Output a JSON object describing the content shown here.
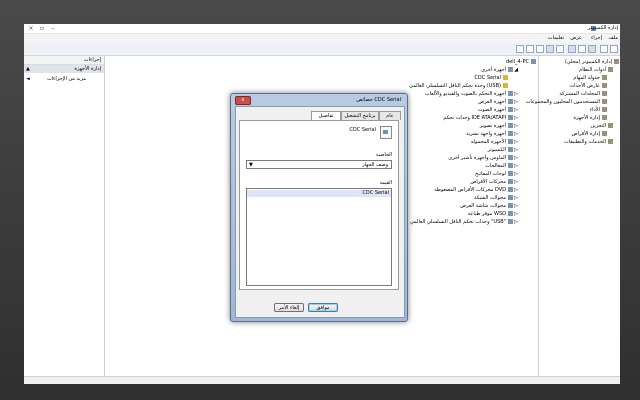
{
  "window": {
    "title": "إدارة الكمبيوتر",
    "controls": {
      "close": "×",
      "maximize": "▫",
      "minimize": "–"
    }
  },
  "menu": [
    "ملف",
    "إجراء",
    "عرض",
    "تعليمات"
  ],
  "left_pane": {
    "header": "إجراءات",
    "selected": "إدارة الأجهزة",
    "more_actions": "مزيد من الإجراءات"
  },
  "device_tree": {
    "root": "dell_4-PC",
    "items": [
      "أجهزة أخرى",
      "CDC Serial",
      "وحدة تحكم الناقل التسلسلي العالمي (USB)",
      "أجهزة التحكم بالصوت والفيديو والألعاب",
      "أجهزة العرض",
      "أجهزة الصوت",
      "وحدات تحكم IDE ATA/ATAPI",
      "أجهزة تصوير",
      "أجهزة واجهة بشرية",
      "الأجهزة المحمولة",
      "الكمبيوتر",
      "الماوس وأجهزة تأشير أخرى",
      "المعالجات",
      "لوحات المفاتيح",
      "محركات الأقراص",
      "محركات الأقراص المضغوطة DVD",
      "محولات الشبكة",
      "محولات شاشة العرض",
      "موفر طباعة WSD",
      "وحدات تحكم الناقل التسلسلي العالمي \"USB\""
    ]
  },
  "nav_tree": {
    "items": [
      "إدارة الكمبيوتر (محلي)",
      "أدوات النظام",
      "جدولة المهام",
      "عارض الأحداث",
      "المجلدات المشتركة",
      "المستخدمون المحليون والمجموعات",
      "الأداء",
      "إدارة الأجهزة",
      "التخزين",
      "إدارة الأقراص",
      "الخدمات والتطبيقات"
    ]
  },
  "dialog": {
    "title": "خصائص CDC Serial",
    "close": "x",
    "tabs": [
      "عام",
      "برنامج التشغيل",
      "تفاصيل"
    ],
    "device_name": "CDC Serial",
    "property_label": "الخاصية",
    "property_value": "وصف الجهاز",
    "value_label": "القيمة",
    "values": [
      "CDC Serial"
    ],
    "ok": "موافق",
    "cancel": "إلغاء الأمر"
  }
}
